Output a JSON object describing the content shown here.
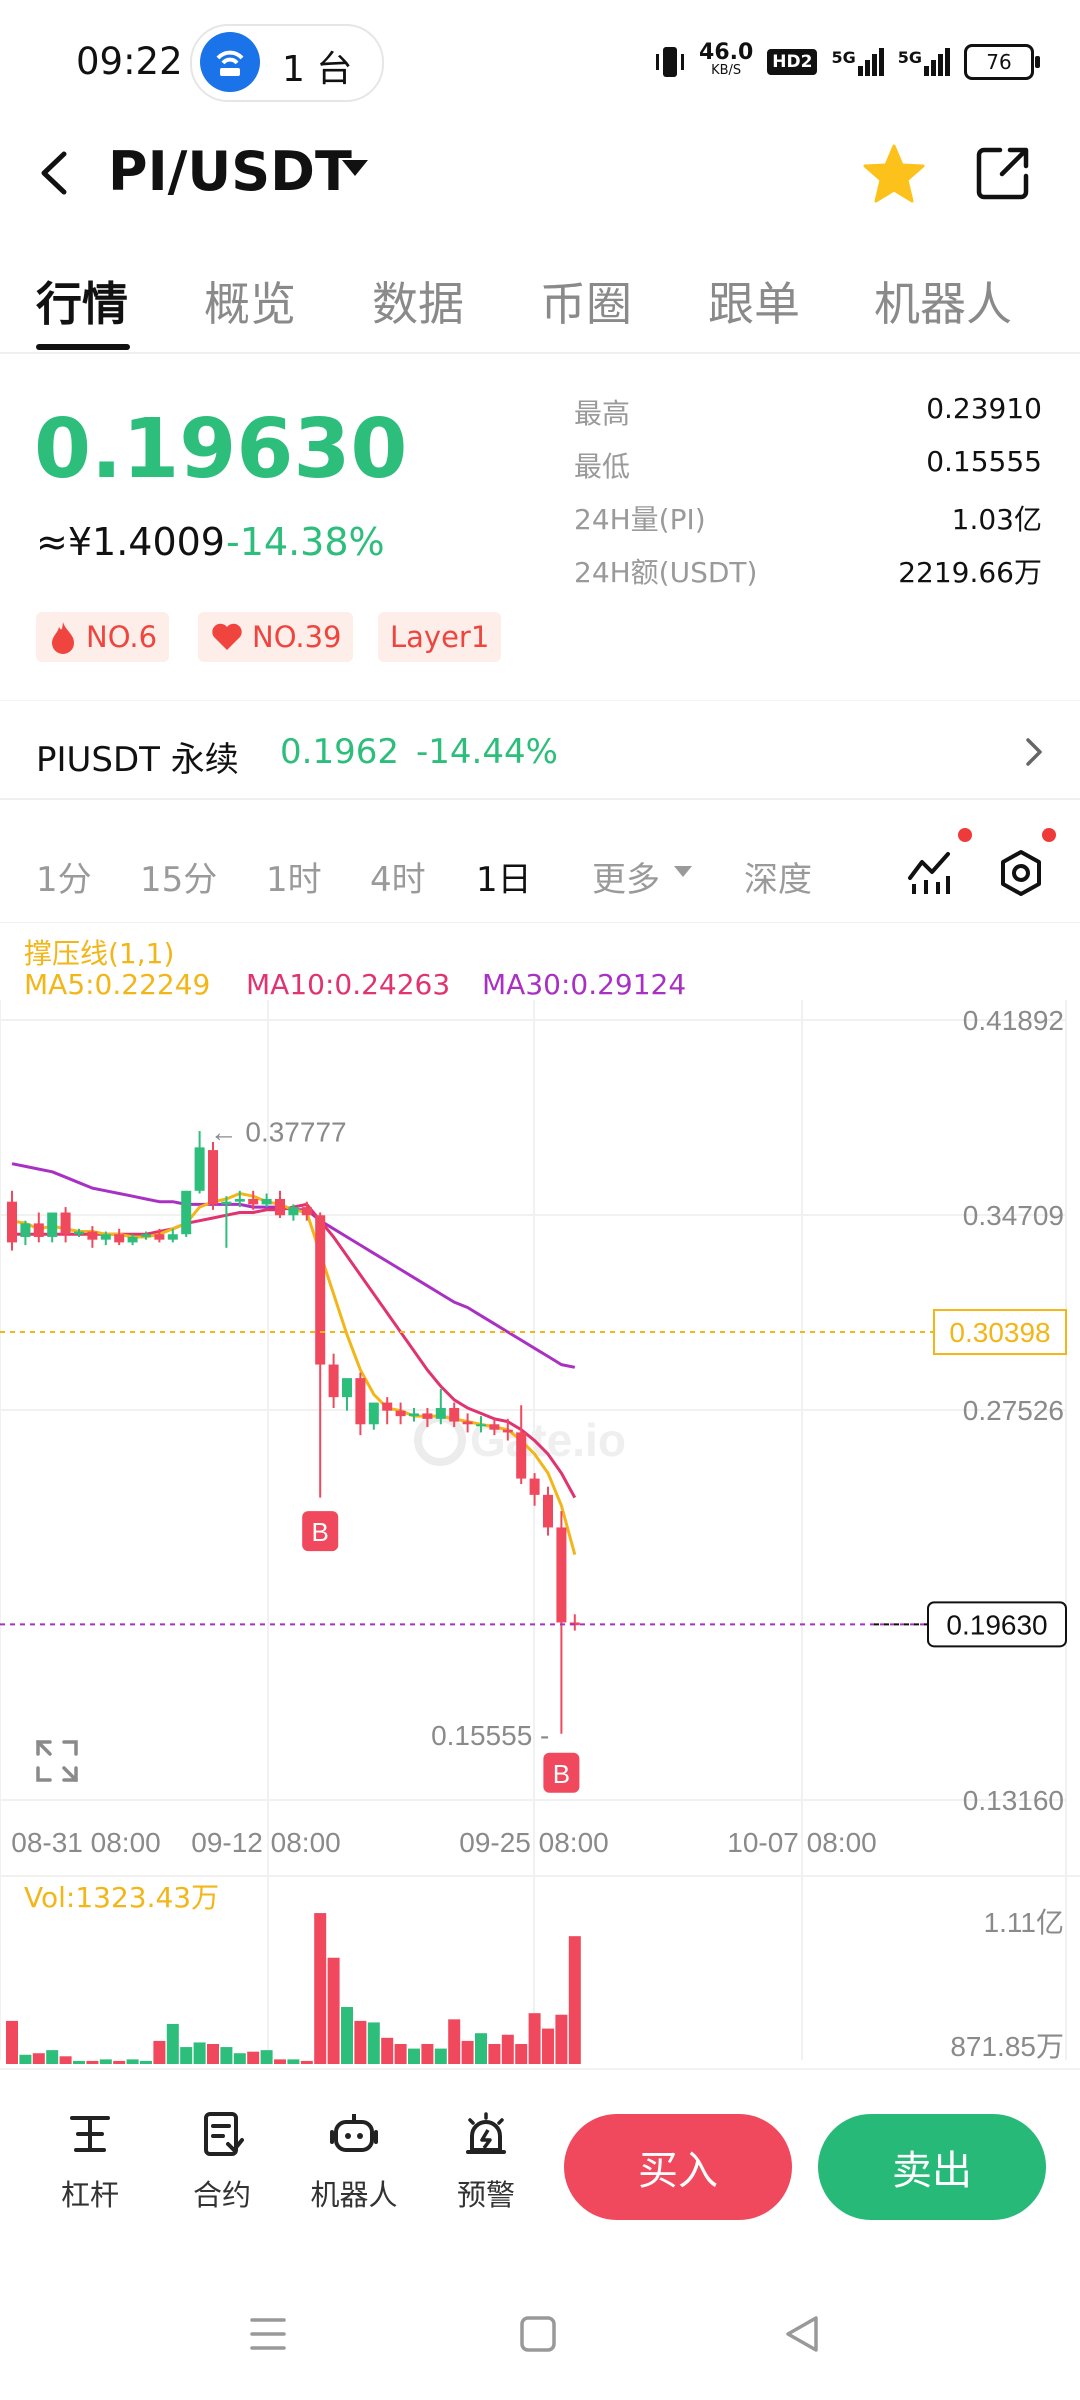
{
  "status_bar": {
    "time": "09:22",
    "hotspot_label": "1 台",
    "net_speed_top": "46.0",
    "net_speed_unit": "KB/S",
    "hd_label": "HD2",
    "signal1": "5G",
    "signal2": "5G",
    "battery": "76"
  },
  "header": {
    "pair": "PI/USDT"
  },
  "tabs": [
    "行情",
    "概览",
    "数据",
    "币圈",
    "跟单",
    "机器人"
  ],
  "price": {
    "last": "0.19630",
    "cny": "≈¥1.4009",
    "change_pct": "-14.38%"
  },
  "badges": [
    "NO.6",
    "NO.39",
    "Layer1"
  ],
  "stats": [
    {
      "label": "最高",
      "value": "0.23910"
    },
    {
      "label": "最低",
      "value": "0.15555"
    },
    {
      "label": "24H量(PI)",
      "value": "1.03亿"
    },
    {
      "label": "24H额(USDT)",
      "value": "2219.66万"
    }
  ],
  "perpetual": {
    "name": "PIUSDT 永续",
    "price": "0.1962",
    "change_pct": "-14.44%"
  },
  "intervals": [
    "1分",
    "15分",
    "1时",
    "4时",
    "1日",
    "更多",
    "深度"
  ],
  "active_interval": "1日",
  "indicators": {
    "sr_label": "撑压线(1,1)",
    "ma5": "MA5:0.22249",
    "ma10": "MA10:0.24263",
    "ma30": "MA30:0.29124"
  },
  "chart_colors": {
    "up": "#2dbe7c",
    "down": "#f0485c",
    "ma5": "#f3b619",
    "ma10": "#e0336f",
    "ma30": "#a831c4",
    "resistance": "#f3b619",
    "current": "#a831c4"
  },
  "chart_data": {
    "type": "candlestick",
    "y_axis_labels": [
      "0.41892",
      "0.34709",
      "0.30398",
      "0.27526",
      "0.19630",
      "0.13160"
    ],
    "ylim": [
      0.1316,
      0.41892
    ],
    "x_axis_labels": [
      "08-31 08:00",
      "09-12 08:00",
      "09-25 08:00",
      "10-07 08:00"
    ],
    "high_marker": "← 0.37777",
    "low_marker": "0.15555 -",
    "resistance_level": "0.30398",
    "current_price_label": "0.19630",
    "trade_markers": [
      "B",
      "B"
    ],
    "candles": [
      {
        "o": 0.352,
        "h": 0.356,
        "c": 0.337,
        "l": 0.334
      },
      {
        "o": 0.339,
        "h": 0.345,
        "c": 0.344,
        "l": 0.336
      },
      {
        "o": 0.344,
        "h": 0.348,
        "c": 0.339,
        "l": 0.337
      },
      {
        "o": 0.339,
        "h": 0.342,
        "c": 0.348,
        "l": 0.337
      },
      {
        "o": 0.348,
        "h": 0.35,
        "c": 0.34,
        "l": 0.337
      },
      {
        "o": 0.34,
        "h": 0.342,
        "c": 0.341,
        "l": 0.339
      },
      {
        "o": 0.341,
        "h": 0.343,
        "c": 0.338,
        "l": 0.335
      },
      {
        "o": 0.338,
        "h": 0.341,
        "c": 0.34,
        "l": 0.336
      },
      {
        "o": 0.34,
        "h": 0.342,
        "c": 0.337,
        "l": 0.336
      },
      {
        "o": 0.337,
        "h": 0.34,
        "c": 0.339,
        "l": 0.336
      },
      {
        "o": 0.339,
        "h": 0.341,
        "c": 0.34,
        "l": 0.338
      },
      {
        "o": 0.34,
        "h": 0.342,
        "c": 0.338,
        "l": 0.337
      },
      {
        "o": 0.338,
        "h": 0.342,
        "c": 0.34,
        "l": 0.337
      },
      {
        "o": 0.34,
        "h": 0.356,
        "c": 0.356,
        "l": 0.339
      },
      {
        "o": 0.356,
        "h": 0.378,
        "c": 0.372,
        "l": 0.355
      },
      {
        "o": 0.371,
        "h": 0.374,
        "c": 0.351,
        "l": 0.349
      },
      {
        "o": 0.351,
        "h": 0.354,
        "c": 0.352,
        "l": 0.335
      },
      {
        "o": 0.352,
        "h": 0.356,
        "c": 0.353,
        "l": 0.35
      },
      {
        "o": 0.353,
        "h": 0.356,
        "c": 0.351,
        "l": 0.349
      },
      {
        "o": 0.351,
        "h": 0.355,
        "c": 0.353,
        "l": 0.35
      },
      {
        "o": 0.353,
        "h": 0.356,
        "c": 0.347,
        "l": 0.346
      },
      {
        "o": 0.347,
        "h": 0.351,
        "c": 0.35,
        "l": 0.345
      },
      {
        "o": 0.35,
        "h": 0.352,
        "c": 0.347,
        "l": 0.345
      },
      {
        "o": 0.347,
        "h": 0.348,
        "c": 0.292,
        "l": 0.243
      },
      {
        "o": 0.292,
        "h": 0.296,
        "c": 0.28,
        "l": 0.276
      },
      {
        "o": 0.28,
        "h": 0.286,
        "c": 0.287,
        "l": 0.275
      },
      {
        "o": 0.287,
        "h": 0.289,
        "c": 0.27,
        "l": 0.266
      },
      {
        "o": 0.27,
        "h": 0.275,
        "c": 0.278,
        "l": 0.268
      },
      {
        "o": 0.278,
        "h": 0.28,
        "c": 0.275,
        "l": 0.27
      },
      {
        "o": 0.275,
        "h": 0.278,
        "c": 0.273,
        "l": 0.27
      },
      {
        "o": 0.273,
        "h": 0.276,
        "c": 0.274,
        "l": 0.271
      },
      {
        "o": 0.274,
        "h": 0.276,
        "c": 0.272,
        "l": 0.269
      },
      {
        "o": 0.272,
        "h": 0.283,
        "c": 0.276,
        "l": 0.27
      },
      {
        "o": 0.276,
        "h": 0.278,
        "c": 0.271,
        "l": 0.269
      },
      {
        "o": 0.271,
        "h": 0.274,
        "c": 0.27,
        "l": 0.267
      },
      {
        "o": 0.27,
        "h": 0.273,
        "c": 0.27,
        "l": 0.267
      },
      {
        "o": 0.27,
        "h": 0.272,
        "c": 0.268,
        "l": 0.266
      },
      {
        "o": 0.268,
        "h": 0.272,
        "c": 0.267,
        "l": 0.264
      },
      {
        "o": 0.267,
        "h": 0.277,
        "c": 0.25,
        "l": 0.248
      },
      {
        "o": 0.25,
        "h": 0.252,
        "c": 0.244,
        "l": 0.24
      },
      {
        "o": 0.244,
        "h": 0.247,
        "c": 0.232,
        "l": 0.229
      },
      {
        "o": 0.232,
        "h": 0.238,
        "c": 0.197,
        "l": 0.156
      },
      {
        "o": 0.197,
        "h": 0.2,
        "c": 0.196,
        "l": 0.194
      }
    ],
    "ma5": [
      0.345,
      0.344,
      0.342,
      0.343,
      0.342,
      0.341,
      0.341,
      0.34,
      0.34,
      0.339,
      0.339,
      0.34,
      0.342,
      0.344,
      0.35,
      0.352,
      0.353,
      0.355,
      0.354,
      0.352,
      0.351,
      0.349,
      0.348,
      0.333,
      0.318,
      0.303,
      0.29,
      0.281,
      0.276,
      0.275,
      0.273,
      0.273,
      0.273,
      0.272,
      0.271,
      0.27,
      0.269,
      0.268,
      0.264,
      0.259,
      0.252,
      0.24,
      0.222
    ],
    "ma10": [
      0.34,
      0.34,
      0.34,
      0.34,
      0.34,
      0.34,
      0.34,
      0.34,
      0.34,
      0.34,
      0.34,
      0.341,
      0.342,
      0.344,
      0.345,
      0.346,
      0.347,
      0.348,
      0.348,
      0.349,
      0.349,
      0.35,
      0.351,
      0.345,
      0.339,
      0.332,
      0.325,
      0.318,
      0.311,
      0.304,
      0.297,
      0.29,
      0.284,
      0.279,
      0.276,
      0.274,
      0.272,
      0.271,
      0.268,
      0.264,
      0.259,
      0.252,
      0.243
    ],
    "ma30": [
      0.366,
      0.365,
      0.364,
      0.363,
      0.361,
      0.359,
      0.357,
      0.356,
      0.355,
      0.354,
      0.353,
      0.352,
      0.352,
      0.351,
      0.351,
      0.351,
      0.351,
      0.351,
      0.35,
      0.35,
      0.35,
      0.349,
      0.349,
      0.345,
      0.342,
      0.339,
      0.336,
      0.333,
      0.33,
      0.327,
      0.324,
      0.321,
      0.318,
      0.315,
      0.313,
      0.31,
      0.307,
      0.304,
      0.301,
      0.298,
      0.295,
      0.292,
      0.291
    ],
    "volume_label": "Vol:1323.43万",
    "volume_axis_labels": [
      "1.11亿",
      "871.85万"
    ],
    "volume": [
      0.28,
      0.06,
      0.07,
      0.09,
      0.05,
      0.02,
      0.02,
      0.03,
      0.02,
      0.03,
      0.02,
      0.15,
      0.26,
      0.11,
      0.14,
      0.13,
      0.11,
      0.07,
      0.08,
      0.09,
      0.03,
      0.03,
      0.02,
      0.98,
      0.69,
      0.37,
      0.28,
      0.27,
      0.17,
      0.13,
      0.1,
      0.13,
      0.1,
      0.29,
      0.15,
      0.2,
      0.13,
      0.19,
      0.13,
      0.33,
      0.23,
      0.32,
      0.83
    ]
  },
  "bottom_bar": {
    "items": [
      "杠杆",
      "合约",
      "机器人",
      "预警"
    ],
    "buy": "买入",
    "sell": "卖出"
  }
}
